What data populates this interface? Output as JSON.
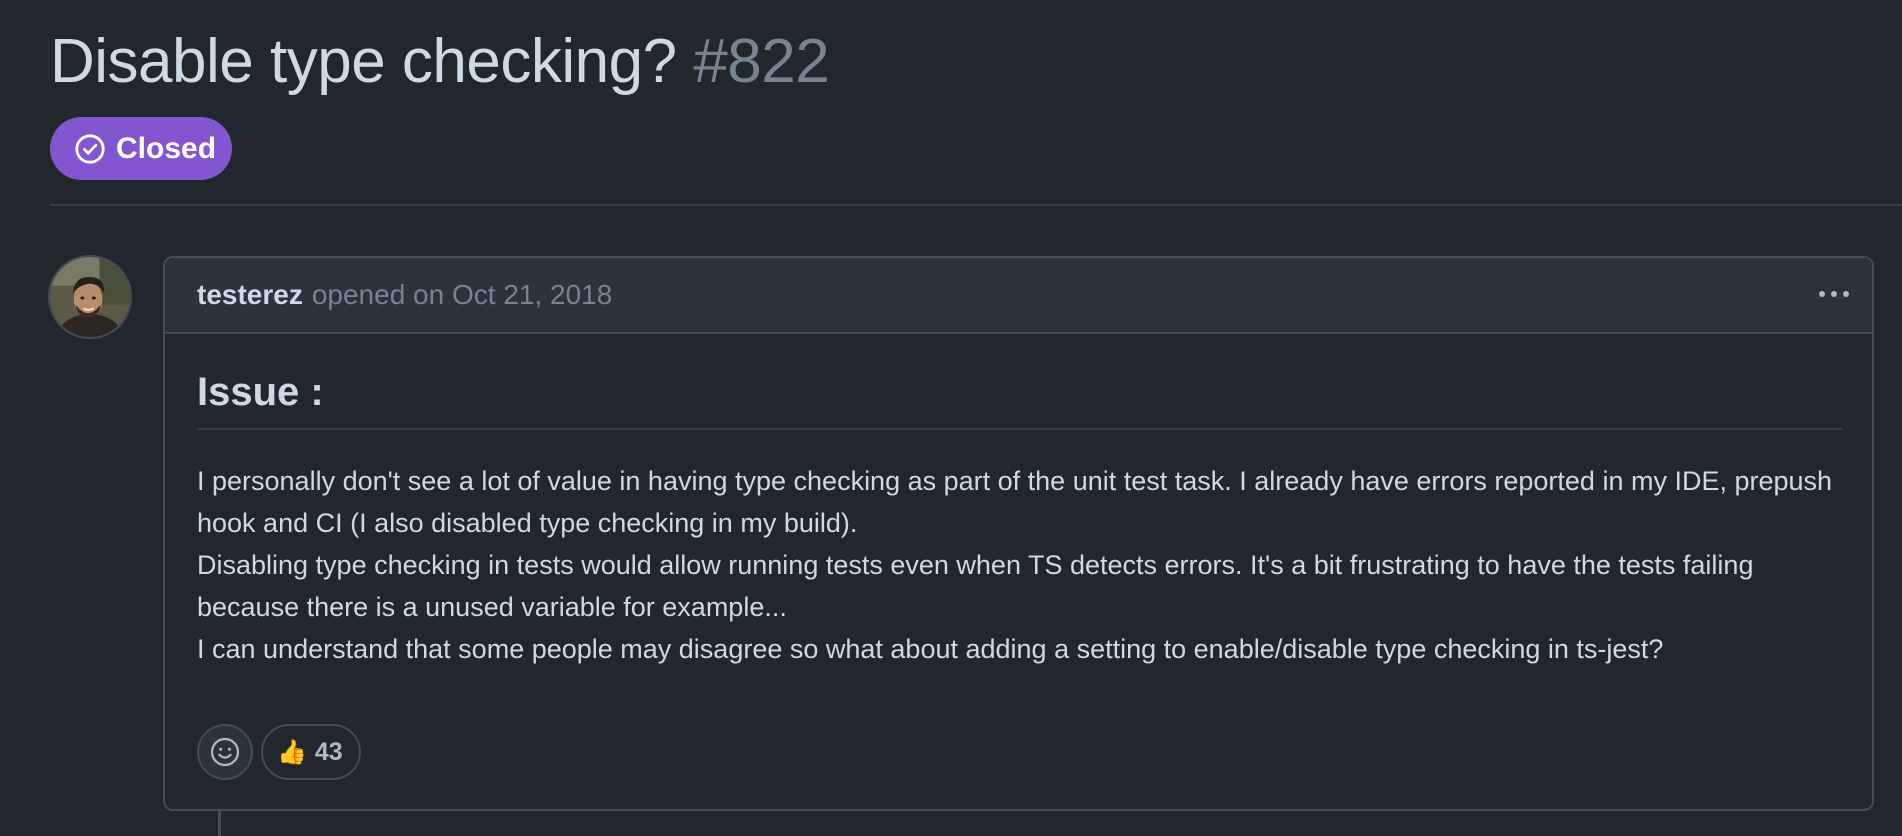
{
  "issue": {
    "title": "Disable type checking?",
    "number": "#822",
    "state": "Closed"
  },
  "comment": {
    "author": "testerez",
    "opened_text": "opened on Oct 21, 2018",
    "heading": "Issue :",
    "paragraphs": [
      "I personally don't see a lot of value in having type checking as part of the unit test task. I already have errors reported in my IDE, prepush hook and CI (I also disabled type checking in my build).",
      "Disabling type checking in tests would allow running tests even when TS detects errors. It's a bit frustrating to have the tests failing because there is a unused variable for example...",
      "I can understand that some people may disagree so what about adding a setting to enable/disable type checking in ts-jest?"
    ],
    "reactions": [
      {
        "emoji": "👍",
        "icon": "thumbs-up",
        "count": "43"
      }
    ]
  },
  "colors": {
    "background": "#22272e",
    "closed_badge": "#8256d0",
    "border": "#444c56"
  }
}
